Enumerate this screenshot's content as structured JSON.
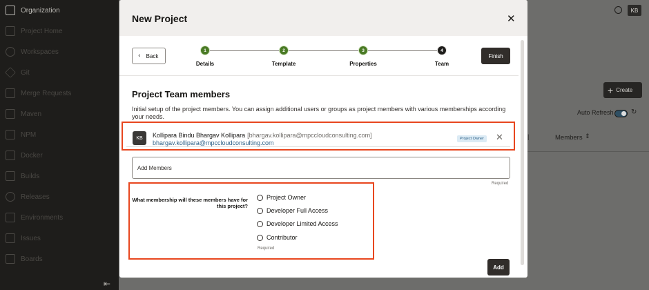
{
  "sidebar": {
    "items": [
      {
        "label": "Organization",
        "icon": "building-icon"
      },
      {
        "label": "Project Home",
        "icon": "home-icon"
      },
      {
        "label": "Workspaces",
        "icon": "person-icon"
      },
      {
        "label": "Git",
        "icon": "git-icon"
      },
      {
        "label": "Merge Requests",
        "icon": "merge-icon"
      },
      {
        "label": "Maven",
        "icon": "maven-icon"
      },
      {
        "label": "NPM",
        "icon": "npm-icon"
      },
      {
        "label": "Docker",
        "icon": "docker-icon"
      },
      {
        "label": "Builds",
        "icon": "builds-icon"
      },
      {
        "label": "Releases",
        "icon": "releases-icon"
      },
      {
        "label": "Environments",
        "icon": "environments-icon"
      },
      {
        "label": "Issues",
        "icon": "issues-icon"
      },
      {
        "label": "Boards",
        "icon": "boards-icon"
      }
    ]
  },
  "topbar": {
    "avatar_initials": "KB"
  },
  "background": {
    "create_label": "Create",
    "auto_refresh_label": "Auto Refresh",
    "members_column": "Members"
  },
  "modal": {
    "title": "New Project",
    "back_label": "Back",
    "finish_label": "Finish",
    "steps": [
      {
        "number": "1",
        "label": "Details",
        "state": "done"
      },
      {
        "number": "2",
        "label": "Template",
        "state": "done"
      },
      {
        "number": "3",
        "label": "Properties",
        "state": "done"
      },
      {
        "number": "4",
        "label": "Team",
        "state": "current"
      }
    ],
    "section_title": "Project Team members",
    "section_description": "Initial setup of the project members. You can assign additional users or groups as project members with various memberships according your needs.",
    "member": {
      "initials": "KB",
      "name": "Kollipara Bindu Bhargav Kollipara",
      "email_bracketed": "[bhargav.kollipara@mpccloudconsulting.com]",
      "email": "bhargav.kollipara@mpccloudconsulting.com",
      "badge": "Project Owner"
    },
    "add_members_placeholder": "Add Members",
    "required_label": "Required",
    "membership_question": "What membership will these members have for this project?",
    "membership_options": [
      "Project Owner",
      "Developer Full Access",
      "Developer Limited Access",
      "Contributor"
    ],
    "add_label": "Add"
  },
  "colors": {
    "highlight": "#e8461e",
    "step_done": "#4a7a25",
    "primary_button": "#312d2a",
    "link": "#2b5f86"
  }
}
